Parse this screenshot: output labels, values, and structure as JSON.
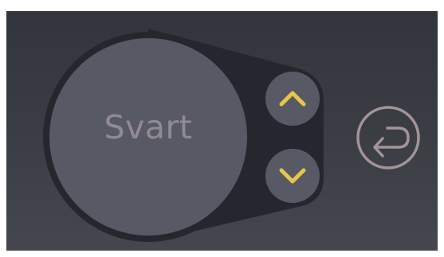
{
  "control": {
    "selected_value": "Svart"
  },
  "buttons": {
    "up_icon": "chevron-up-icon",
    "down_icon": "chevron-down-icon",
    "back_icon": "return-arrow-icon"
  },
  "colors": {
    "background_top": "#33353d",
    "background_bottom": "#45474f",
    "housing": "#26262e",
    "dial_face": "#575964",
    "button_face": "#575964",
    "chevron_accent": "#e6c54e",
    "label_text": "#928a93",
    "back_icon": "#a39497"
  }
}
